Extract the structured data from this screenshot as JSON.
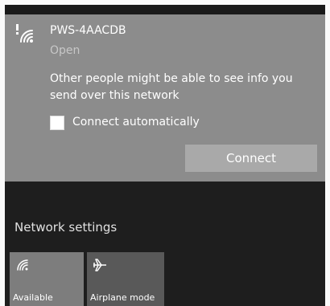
{
  "network": {
    "name": "PWS-4AACDB",
    "status": "Open",
    "warning": "Other people might be able to see info you send over this network",
    "auto_connect_label": "Connect automatically",
    "auto_connect_checked": false,
    "connect_label": "Connect"
  },
  "settings": {
    "label": "Network settings"
  },
  "quick_actions": [
    {
      "label": "Available",
      "icon": "wifi-icon"
    },
    {
      "label": "Airplane mode",
      "icon": "airplane-icon"
    }
  ]
}
